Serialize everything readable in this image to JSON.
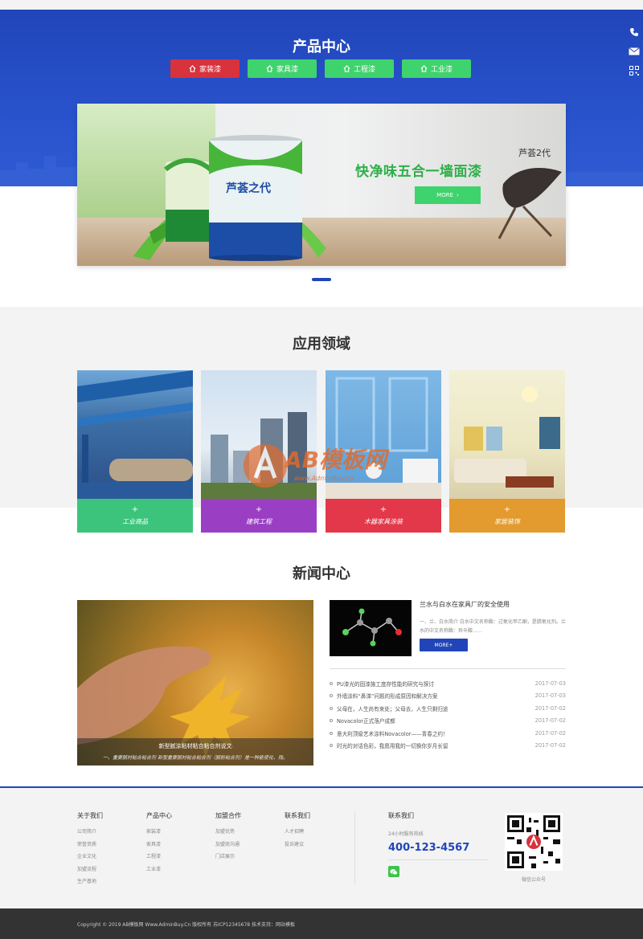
{
  "products": {
    "title": "产品中心",
    "tabs": [
      {
        "label": "家装漆",
        "active": true
      },
      {
        "label": "家具漆",
        "active": false
      },
      {
        "label": "工程漆",
        "active": false
      },
      {
        "label": "工业漆",
        "active": false
      }
    ],
    "banner": {
      "slogan_small": "芦荟2代",
      "slogan_big": "快净味五合一墙面漆",
      "more_label": "MORE",
      "can_text": "芦荟之代"
    }
  },
  "side_icons": [
    "phone-icon",
    "mail-icon",
    "qrcode-icon"
  ],
  "applications": {
    "title": "应用领域",
    "items": [
      {
        "label": "工业商品",
        "color": "#3cc47c"
      },
      {
        "label": "建筑工程",
        "color": "#9a3fc4"
      },
      {
        "label": "木器家具涂装",
        "color": "#e2384a"
      },
      {
        "label": "家居装饰",
        "color": "#e39a2e"
      }
    ]
  },
  "watermark": {
    "text": "AB模板网",
    "sub": "www.AdminBuy.cn"
  },
  "news": {
    "title": "新闻中心",
    "main": {
      "title": "新型腻涂粘材粘合粘合剂说文",
      "desc": "一、重要腻材粘合粘合剂 新型重要腻材粘合粘合剂（腻粉粘合剂）是一种能使化、残。"
    },
    "feature": {
      "title": "兰水与白水在家具厂的安全使用",
      "desc": "一、兰、白水简介 白水中文名称酯：过氧化甲乙酮，是腈氧化剂。兰水的中文名称酯：异辛酸……",
      "more_label": "MORE+"
    },
    "items": [
      {
        "title": "PU漆光的固漆施工度存性能的研究与探讨",
        "date": "2017-07-03"
      },
      {
        "title": "外墙涂料“鼻涕”问题的形成原因和解决方案",
        "date": "2017-07-03"
      },
      {
        "title": "父母在，人生尚有来处；父母去，人生只剩归途",
        "date": "2017-07-02"
      },
      {
        "title": "Novacolor正式落户成都",
        "date": "2017-07-02"
      },
      {
        "title": "意大利顶级艺术涂料Novacolor——青春之约！",
        "date": "2017-07-02"
      },
      {
        "title": "时光的对话色彩，我愿用我的一切换你岁月长留",
        "date": "2017-07-02"
      }
    ]
  },
  "footer": {
    "columns": [
      {
        "heading": "关于我们",
        "items": [
          "公司简介",
          "荣誉资质",
          "企业文化",
          "加盟流程",
          "生产基地"
        ]
      },
      {
        "heading": "产品中心",
        "items": [
          "家装漆",
          "家具漆",
          "工程漆",
          "工业漆"
        ]
      },
      {
        "heading": "加盟合作",
        "items": [
          "加盟优势",
          "加盟商沟通",
          "门店展示"
        ]
      },
      {
        "heading": "联系我们",
        "items": [
          "人才招聘",
          "投诉建议"
        ]
      }
    ],
    "contact": {
      "heading": "联系我们",
      "sub": "24小时服务热线",
      "phone": "400-123-4567"
    },
    "qr_caption": "微信公众号",
    "copyright": "Copyright © 2019 AB模板网 Www.AdminBuy.Cn 版权所有   苏ICP12345678   技术支持：网站模板"
  },
  "colors": {
    "brand_blue": "#2145b9",
    "green": "#3fd36d",
    "red": "#d8323c"
  }
}
